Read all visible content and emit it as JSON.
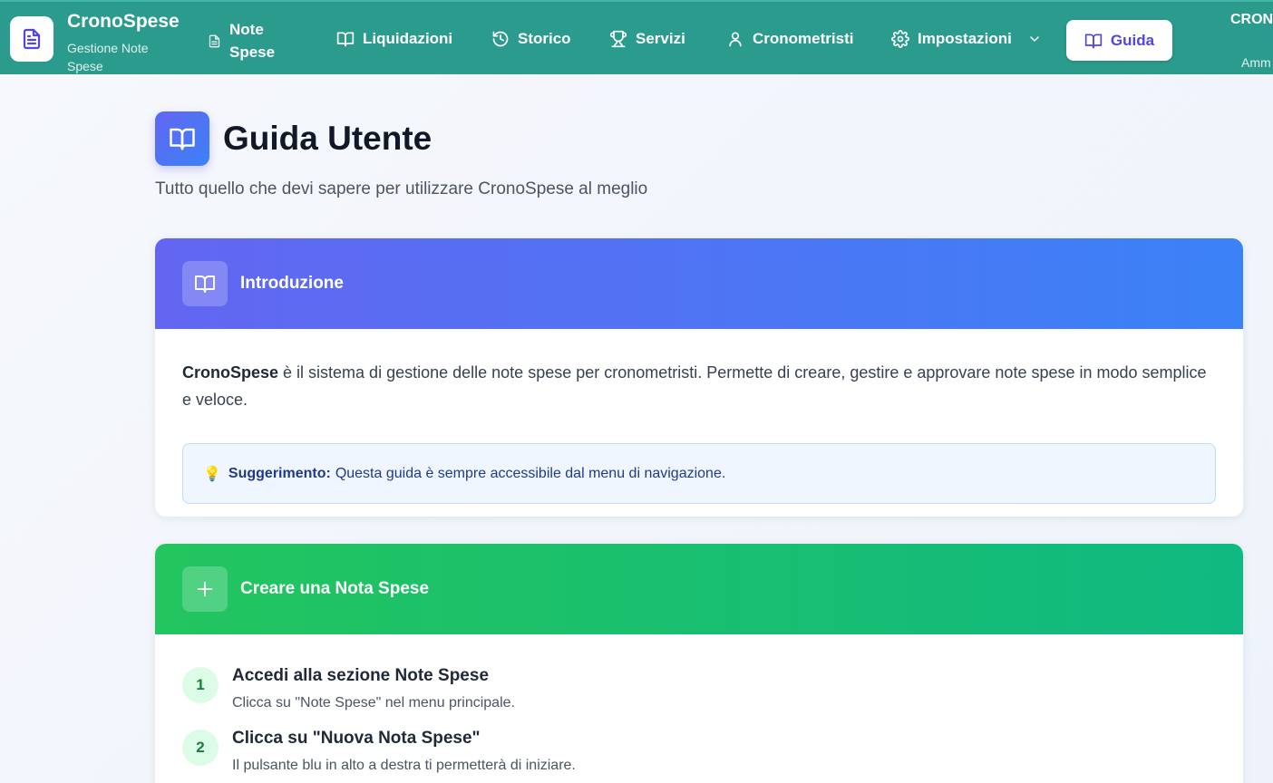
{
  "header": {
    "brand": {
      "title": "CronoSpese",
      "subtitle": "Gestione Note Spese"
    },
    "nav": {
      "note_spese": "Note Spese",
      "liquidazioni": "Liquidazioni",
      "storico": "Storico",
      "servizi": "Servizi",
      "cronometristi": "Cronometristi",
      "impostazioni": "Impostazioni",
      "guida": "Guida"
    },
    "user": {
      "name": "CRON",
      "role": "Amm"
    }
  },
  "page": {
    "title": "Guida Utente",
    "subtitle": "Tutto quello che devi sapere per utilizzare CronoSpese al meglio"
  },
  "sections": {
    "intro": {
      "title": "Introduzione",
      "brand_word": "CronoSpese",
      "text": " è il sistema di gestione delle note spese per cronometristi. Permette di creare, gestire e approvare note spese in modo semplice e veloce.",
      "tip_label": "Suggerimento:",
      "tip_text": "Questa guida è sempre accessibile dal menu di navigazione."
    },
    "create": {
      "title": "Creare una Nota Spese",
      "steps": [
        {
          "num": "1",
          "title": "Accedi alla sezione Note Spese",
          "desc": "Clicca su \"Note Spese\" nel menu principale."
        },
        {
          "num": "2",
          "title": "Clicca su \"Nuova Nota Spese\"",
          "desc": "Il pulsante blu in alto a destra ti permetterà di iniziare."
        }
      ]
    }
  },
  "colors": {
    "header_bg": "#2a9b8c",
    "accent_indigo": "#4f46e5",
    "intro_gradient": [
      "#6366f1",
      "#3b82f6"
    ],
    "create_gradient": [
      "#22c55e",
      "#10b981"
    ]
  }
}
